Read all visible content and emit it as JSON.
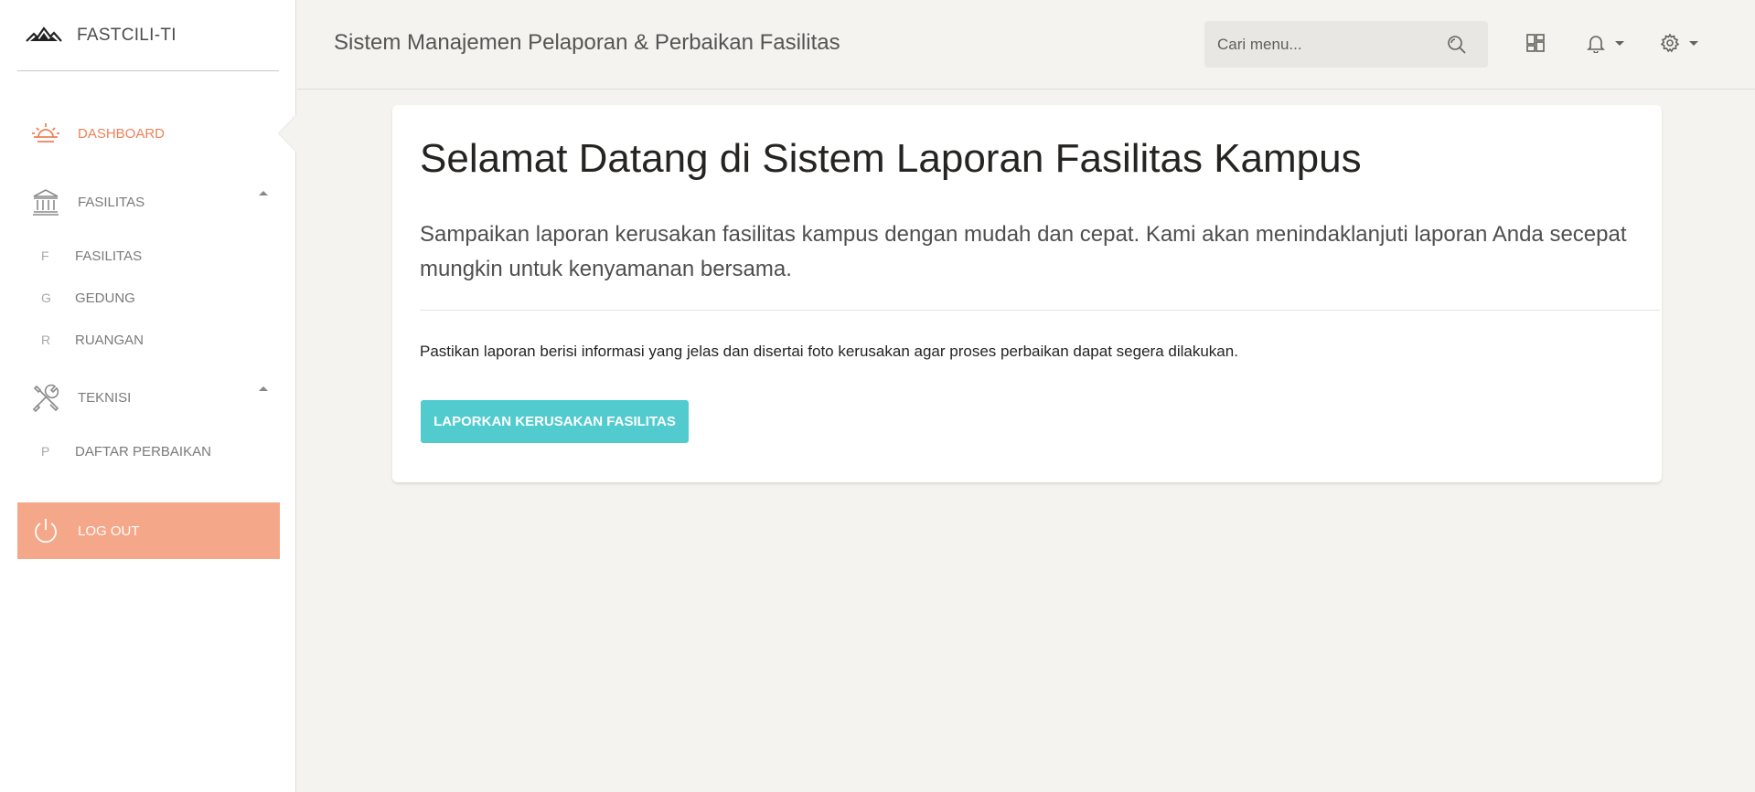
{
  "brand": {
    "name": "FASTCILI-TI",
    "logo_icon": "mountain-logo-icon"
  },
  "sidebar": {
    "items": [
      {
        "label": "DASHBOARD",
        "icon": "sunrise-icon",
        "active": true
      },
      {
        "label": "FASILITAS",
        "icon": "bank-icon",
        "expanded": true,
        "children": [
          {
            "mini": "F",
            "label": "FASILITAS"
          },
          {
            "mini": "G",
            "label": "GEDUNG"
          },
          {
            "mini": "R",
            "label": "RUANGAN"
          }
        ]
      },
      {
        "label": "TEKNISI",
        "icon": "tools-icon",
        "expanded": true,
        "children": [
          {
            "mini": "P",
            "label": "DAFTAR PERBAIKAN"
          }
        ]
      }
    ],
    "logout": {
      "label": "LOG OUT",
      "icon": "power-icon"
    }
  },
  "header": {
    "title": "Sistem Manajemen Pelaporan & Perbaikan Fasilitas",
    "search_placeholder": "Cari menu...",
    "icons": [
      "search-icon",
      "dashboard-grid-icon",
      "bell-icon",
      "gear-icon"
    ]
  },
  "main": {
    "heading": "Selamat Datang di Sistem Laporan Fasilitas Kampus",
    "lead": "Sampaikan laporan kerusakan fasilitas kampus dengan mudah dan cepat. Kami akan menindaklanjuti laporan Anda secepat mungkin untuk kenyamanan bersama.",
    "note": "Pastikan laporan berisi informasi yang jelas dan disertai foto kerusakan agar proses perbaikan dapat segera dilakukan.",
    "cta_label": "LAPORKAN KERUSAKAN FASILITAS"
  },
  "colors": {
    "accent_active": "#ef8157",
    "logout_bg": "#f5a789",
    "cta_bg": "#51cbce",
    "page_bg": "#f4f3ef"
  }
}
